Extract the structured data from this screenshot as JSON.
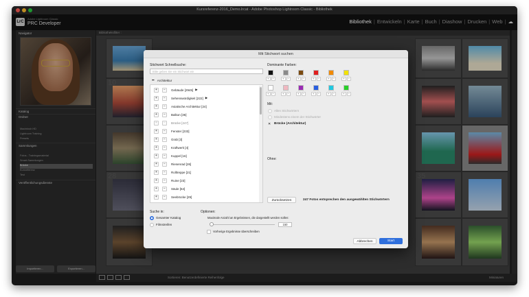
{
  "window": {
    "title": "Kursreferenz-2016_Demo.lrcat - Adobe Photoshop Lightroom Classic - Bibliothek",
    "traffic_colors": [
      "#ff5f57",
      "#febc2e",
      "#28c840"
    ]
  },
  "identity": {
    "badge": "LrC",
    "small_text": "Adobe Lightroom Classic",
    "name": "PRC Developer"
  },
  "modules": {
    "items": [
      "Bibliothek",
      "Entwickeln",
      "Karte",
      "Buch",
      "Diashow",
      "Drucken",
      "Web"
    ],
    "active": "Bibliothek"
  },
  "left_panel": {
    "navigator_label": "Navigator",
    "sections": [
      "Katalog",
      "Ordner",
      "Sammlungen",
      "Veröffentlichungsdienste"
    ],
    "rows": [
      "Macintosh HD",
      "Lightroom Training",
      "Presets",
      "Fotos - Trainingsmaterial",
      "Smart-Sammlungen",
      "Brücke",
      "Kursreferenz",
      "Test"
    ],
    "import_label": "Importieren...",
    "export_label": "Exportieren..."
  },
  "filterbar": {
    "text": "Bibliotheksfilter :"
  },
  "toolbar": {
    "text": "Sortieren: Benutzerdefinierte Reihenfolge",
    "right_text": "Miniaturen"
  },
  "dialog": {
    "title": "Mit Stichwort suchen",
    "search_label": "Stichwort Schnellsuche:",
    "search_placeholder": "Bitte geben Sie ein Stichwort ein",
    "crumb": "Architektur",
    "keywords": [
      {
        "label": "Gebäude [2945]",
        "arrow": "▶",
        "enabled": true
      },
      {
        "label": "Sehenswürdigkeit [222]",
        "arrow": "▶",
        "enabled": true
      },
      {
        "label": "Asiatische Architektur [24]",
        "arrow": "",
        "enabled": true
      },
      {
        "label": "Balkon [36]",
        "arrow": "",
        "enabled": true
      },
      {
        "label": "Brücke [247]",
        "arrow": "",
        "enabled": false
      },
      {
        "label": "Fenster [233]",
        "arrow": "",
        "enabled": true
      },
      {
        "label": "Grab [3]",
        "arrow": "",
        "enabled": true
      },
      {
        "label": "Kraftwerk [4]",
        "arrow": "",
        "enabled": true
      },
      {
        "label": "Kuppel [16]",
        "arrow": "",
        "enabled": true
      },
      {
        "label": "Riesenrad [26]",
        "arrow": "",
        "enabled": true
      },
      {
        "label": "Rolltreppe [21]",
        "arrow": "",
        "enabled": true
      },
      {
        "label": "Ruine [23]",
        "arrow": "",
        "enabled": true
      },
      {
        "label": "Säule [64]",
        "arrow": "",
        "enabled": true
      },
      {
        "label": "Seebrücke [29]",
        "arrow": "",
        "enabled": true
      }
    ],
    "colors_label": "Dominante Farben:",
    "colors_row1": [
      "#111111",
      "#8a8a8a",
      "#7a4a10",
      "#e02020",
      "#f08a00",
      "#f2e200"
    ],
    "colors_row2": [
      "#ffffff",
      "#f0b8c0",
      "#9a2bb4",
      "#2a5fe0",
      "#21c8e0",
      "#28d028"
    ],
    "with_label": "Mit:",
    "with_options": [
      "Allen Stichwörtern",
      "Mindestens einem der Stichwörter"
    ],
    "selected_keyword": "Brücke (Architektur)",
    "without_label": "Ohne:",
    "reset_label": "Zurücksetzen",
    "result_text": "247 Fotos entsprechen den ausgewählten Stichwörtern",
    "search_in_label": "Suche in:",
    "search_in_options": [
      "Gesamter Katalog",
      "Filmstreifen"
    ],
    "options_label": "Optionen:",
    "max_results_text": "Maximale Anzahl an Ergebnissen, die dargestellt werden sollen:",
    "max_results_value": "150",
    "overwrite_label": "Vorherige Ergebnisse überschreiben",
    "cancel_label": "Abbrechen",
    "start_label": "Start"
  }
}
